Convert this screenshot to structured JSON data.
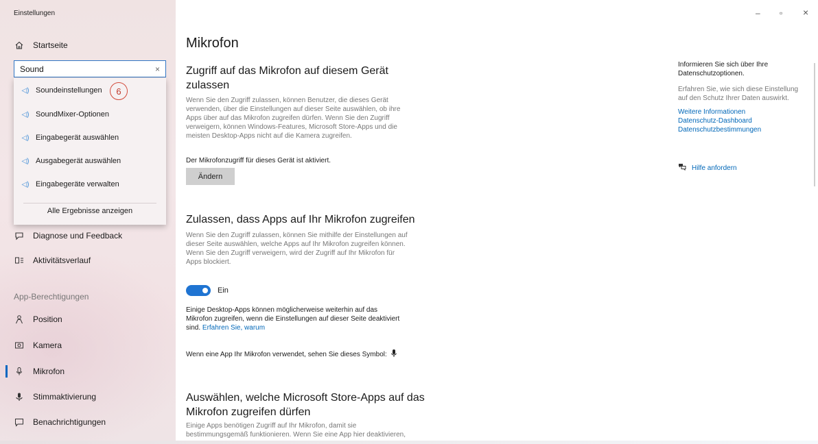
{
  "window": {
    "title": "Einstellungen",
    "controls": {
      "minimize": "–",
      "maximize": "▫",
      "close": "×"
    }
  },
  "sidebar": {
    "home": "Startseite",
    "search": {
      "value": "Sound",
      "clear": "×"
    },
    "suggestions": [
      "Soundeinstellungen",
      "SoundMixer-Optionen",
      "Eingabegerät auswählen",
      "Ausgabegerät auswählen",
      "Eingabegeräte verwalten"
    ],
    "all_results": "Alle Ergebnisse anzeigen",
    "step_marker": "6",
    "items_top": [
      "Diagnose und Feedback",
      "Aktivitätsverlauf"
    ],
    "section_label": "App-Berechtigungen",
    "items_perm": [
      "Position",
      "Kamera",
      "Mikrofon",
      "Stimmaktivierung",
      "Benachrichtigungen"
    ]
  },
  "main": {
    "title": "Mikrofon",
    "section1": {
      "heading_line1": "Zugriff auf das Mikrofon auf diesem Gerät",
      "heading_line2": "zulassen",
      "desc": [
        "Wenn Sie den Zugriff zulassen, können Benutzer, die dieses Gerät",
        "verwenden, über die Einstellungen auf dieser Seite auswählen, ob ihre",
        "Apps über auf das Mikrofon zugreifen dürfen. Wenn Sie den Zugriff",
        "verweigern, können Windows-Features, Microsoft Store-Apps und die",
        "meisten Desktop-Apps nicht auf die Kamera zugreifen."
      ],
      "status": "Der Mikrofonzugriff für dieses Gerät ist aktiviert.",
      "button": "Ändern"
    },
    "section2": {
      "heading": "Zulassen, dass Apps auf Ihr Mikrofon zugreifen",
      "desc": [
        "Wenn Sie den Zugriff zulassen, können Sie mithilfe der Einstellungen auf",
        "dieser Seite auswählen, welche Apps auf Ihr Mikrofon zugreifen können.",
        "Wenn Sie den Zugriff verweigern, wird der Zugriff auf Ihr Mikrofon für",
        "Apps blockiert."
      ],
      "toggle_label": "Ein",
      "note": [
        "Einige Desktop-Apps können möglicherweise weiterhin auf das",
        "Mikrofon zugreifen, wenn die Einstellungen auf dieser Seite deaktiviert",
        "sind."
      ],
      "note_link": "Erfahren Sie, warum",
      "symbol_text": "Wenn eine App Ihr Mikrofon verwendet, sehen Sie dieses Symbol:"
    },
    "section3": {
      "heading_line1": "Auswählen, welche Microsoft Store-Apps auf das",
      "heading_line2": "Mikrofon zugreifen dürfen",
      "desc": [
        "Einige Apps benötigen Zugriff auf Ihr Mikrofon, damit sie",
        "bestimmungsgemäß funktionieren. Wenn Sie eine App hier deaktivieren,"
      ]
    }
  },
  "right": {
    "heading": [
      "Informieren Sie sich über Ihre",
      "Datenschutzoptionen."
    ],
    "desc": [
      "Erfahren Sie, wie sich diese Einstellung",
      "auf den Schutz Ihrer Daten auswirkt."
    ],
    "links": [
      "Weitere Informationen",
      "Datenschutz-Dashboard",
      "Datenschutzbestimmungen"
    ],
    "help": "Hilfe anfordern"
  },
  "colors": {
    "accent": "#0067b8",
    "toggle_on": "#1f74d2",
    "marker": "#d24a3a"
  }
}
